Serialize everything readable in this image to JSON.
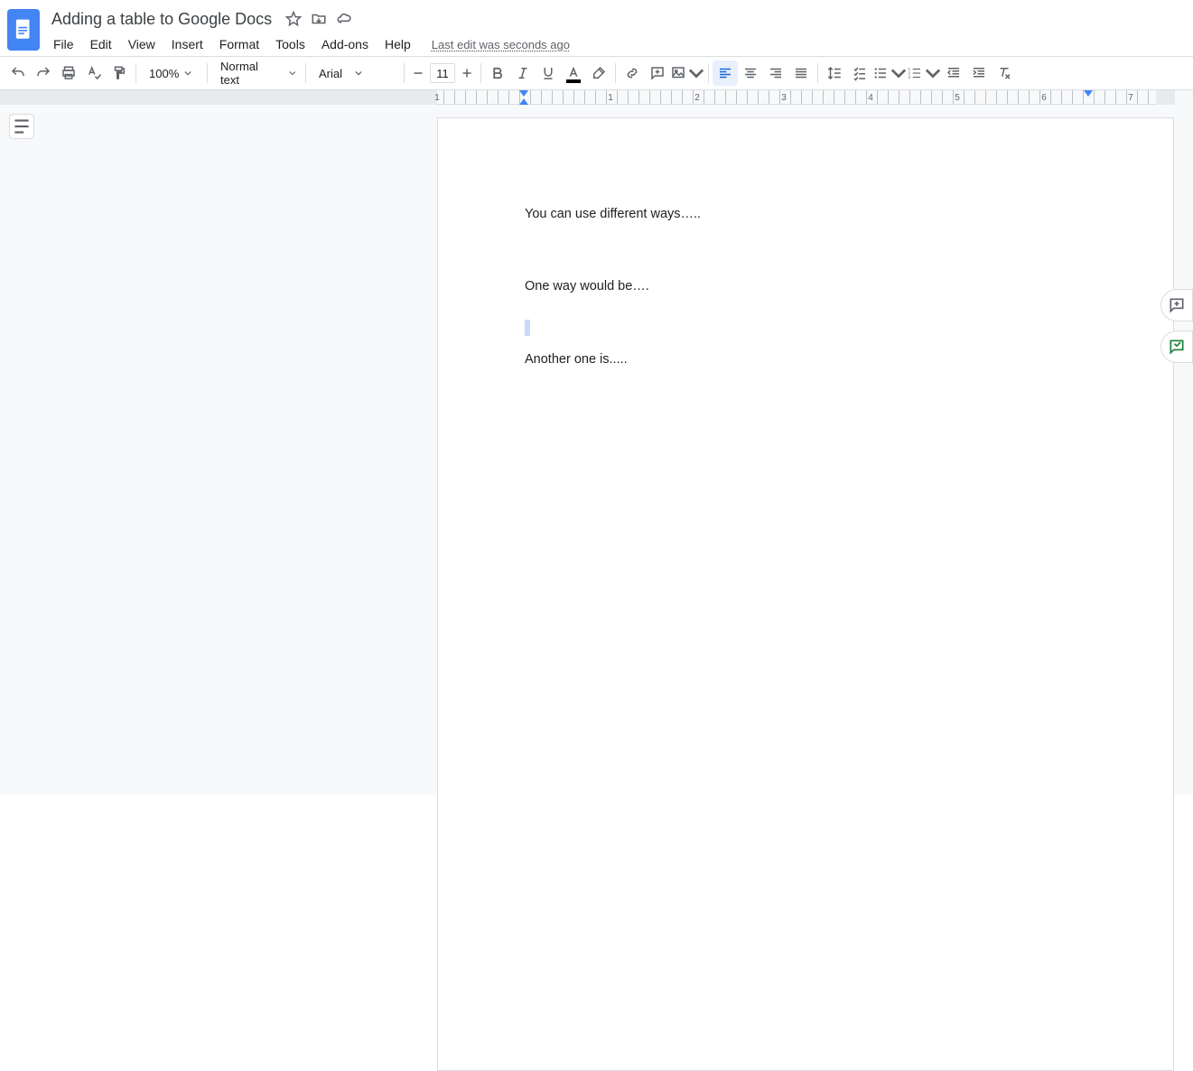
{
  "document": {
    "title": "Adding a table to Google Docs"
  },
  "menu": {
    "items": [
      "File",
      "Edit",
      "View",
      "Insert",
      "Format",
      "Tools",
      "Add-ons",
      "Help"
    ],
    "last_edit": "Last edit was seconds ago"
  },
  "toolbar": {
    "zoom": "100%",
    "paragraph_style": "Normal text",
    "font_family": "Arial",
    "font_size": "11"
  },
  "ruler": {
    "numbers": [
      "1",
      "1",
      "2",
      "3",
      "4",
      "5",
      "6",
      "7"
    ]
  },
  "content": {
    "lines": [
      "You can use different ways…..",
      "One way would be….",
      "Another one is....."
    ]
  }
}
